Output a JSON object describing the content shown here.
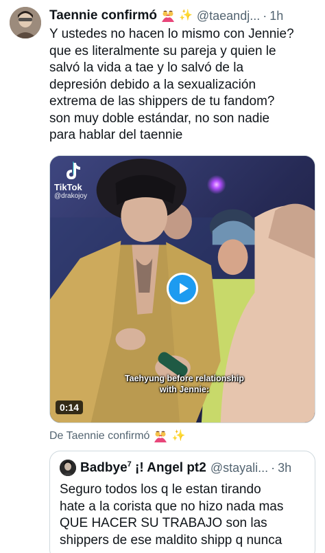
{
  "tweet": {
    "author": {
      "display_name": "Taennie confirmó",
      "handle": "@taeandj...",
      "separator": "·",
      "time": "1h"
    },
    "text": "Y ustedes no hacen lo mismo con Jennie?\nque es literalmente su pareja y quien le\nsalvó la vida a tae y lo salvó de la\ndepresión debido a la sexualización\nextrema de las shippers de tu fandom?\nson muy doble estándar, no son nadie\npara hablar del taennie",
    "media": {
      "watermark_brand": "TikTok",
      "watermark_user": "@drakojoy",
      "caption": "Taehyung before relationship\nwith Jennie:",
      "duration": "0:14"
    },
    "from_label": "De Taennie confirmó",
    "colors": {
      "accent": "#1d9bf0",
      "secondary_text": "#536471",
      "border": "#cfd9de"
    }
  },
  "quote": {
    "display_name": "Badbye",
    "superscript": "7",
    "display_name_suffix": " ¡! Angel pt2",
    "handle": "@stayali...",
    "separator": "·",
    "time": "3h",
    "text": "Seguro todos los q le estan tirando\nhate a la corista que no hizo nada mas\nQUE HACER SU TRABAJO son las\nshippers de ese maldito shipp q nunca"
  },
  "icons": {
    "emoji_1": "kissing-couple-emoji",
    "emoji_2": "sparkles-emoji",
    "play": "play-icon",
    "watermark": "tiktok-logo-icon"
  }
}
